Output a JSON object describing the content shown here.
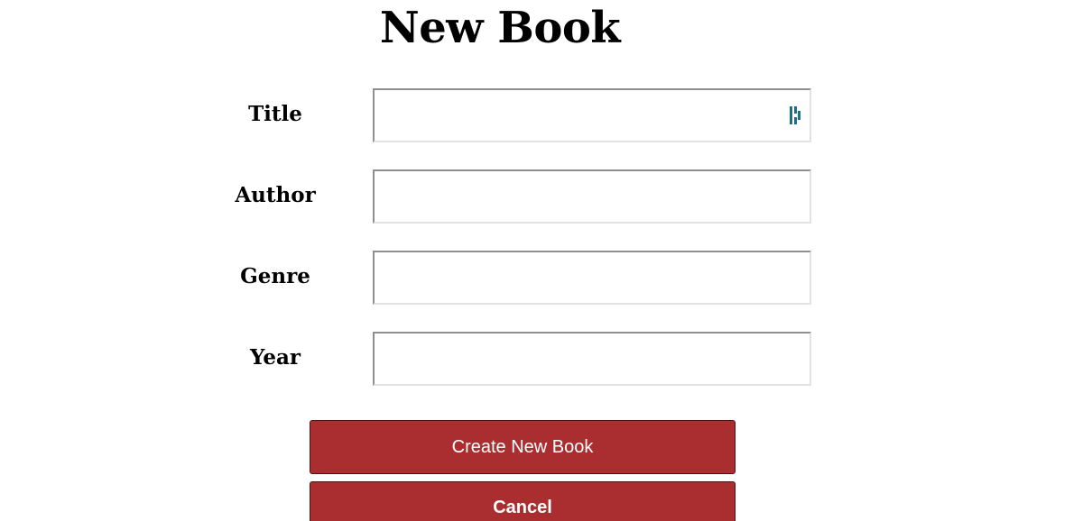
{
  "page": {
    "heading": "New Book"
  },
  "form": {
    "fields": [
      {
        "label": "Title",
        "value": "",
        "placeholder": ""
      },
      {
        "label": "Author",
        "value": "",
        "placeholder": ""
      },
      {
        "label": "Genre",
        "value": "",
        "placeholder": ""
      },
      {
        "label": "Year",
        "value": "",
        "placeholder": ""
      }
    ],
    "submit_label": "Create New Book",
    "cancel_label": "Cancel"
  },
  "colors": {
    "button_bg": "#aa2e30",
    "button_text": "#ffffff",
    "password_manager_icon": "#1f6f86"
  },
  "icons": {
    "title_field_icon": "password-manager-icon"
  }
}
